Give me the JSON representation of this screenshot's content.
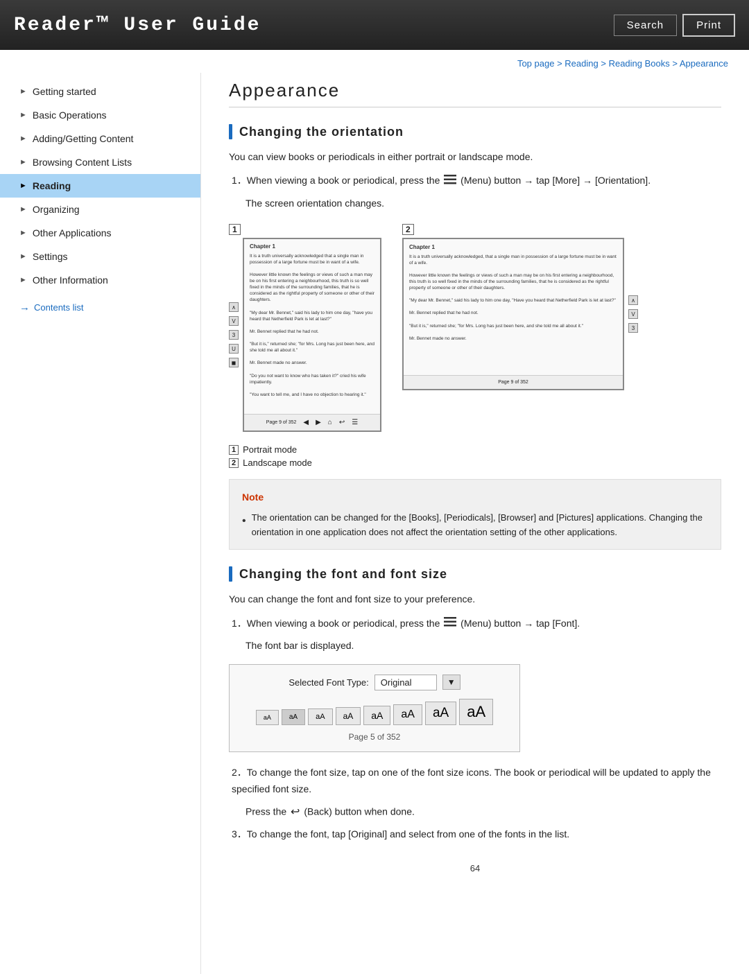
{
  "header": {
    "title": "Reader™ User Guide",
    "search_label": "Search",
    "print_label": "Print"
  },
  "breadcrumb": {
    "items": [
      "Top page",
      "Reading",
      "Reading Books",
      "Appearance"
    ],
    "separator": " > "
  },
  "sidebar": {
    "items": [
      {
        "id": "getting-started",
        "label": "Getting started",
        "active": false
      },
      {
        "id": "basic-operations",
        "label": "Basic Operations",
        "active": false
      },
      {
        "id": "adding-getting-content",
        "label": "Adding/Getting Content",
        "active": false
      },
      {
        "id": "browsing-content-lists",
        "label": "Browsing Content Lists",
        "active": false
      },
      {
        "id": "reading",
        "label": "Reading",
        "active": true
      },
      {
        "id": "organizing",
        "label": "Organizing",
        "active": false
      },
      {
        "id": "other-applications",
        "label": "Other Applications",
        "active": false
      },
      {
        "id": "settings",
        "label": "Settings",
        "active": false
      },
      {
        "id": "other-information",
        "label": "Other Information",
        "active": false
      }
    ],
    "contents_link": "Contents list"
  },
  "main": {
    "page_title": "Appearance",
    "section1": {
      "heading": "Changing the orientation",
      "intro": "You can view books or periodicals in either portrait or landscape mode.",
      "step1_prefix": "1．When viewing a book or periodical, press the",
      "step1_menu_label": "(Menu) button",
      "step1_arrow": "→",
      "step1_tap": "tap [More]",
      "step1_arrow2": "→",
      "step1_suffix": "[Orientation].",
      "step1_sub": "The screen orientation changes.",
      "mode_label1_num": "1",
      "mode_label1_text": "Portrait mode",
      "mode_label2_num": "2",
      "mode_label2_text": "Landscape mode",
      "note_title": "Note",
      "note_text": "The orientation can be changed for the [Books], [Periodicals], [Browser] and [Pictures] applications. Changing the orientation in one application does not affect the orientation setting of the other applications."
    },
    "section2": {
      "heading": "Changing the font and font size",
      "intro": "You can change the font and font size to your preference.",
      "step1_prefix": "1．When viewing a book or periodical, press the",
      "step1_menu_label": "(Menu) button",
      "step1_arrow": "→",
      "step1_tap": "tap [Font].",
      "step1_sub": "The font bar is displayed.",
      "font_bar": {
        "label": "Selected Font Type:",
        "value": "Original",
        "sizes": [
          "aA",
          "aA",
          "aA",
          "aA",
          "aA",
          "aA",
          "aA",
          "aA"
        ],
        "page": "Page 5 of 352"
      },
      "step2": "2．To change the font size, tap on one of the font size icons. The book or periodical will be updated to apply the specified font size.",
      "step2_sub_prefix": "Press the",
      "step2_sub_suffix": "(Back) button when done.",
      "step3": "3．To change the font, tap [Original] and select from one of the fonts in the list."
    },
    "page_number": "64"
  },
  "device_screen_text": {
    "portrait_lines": [
      "Chapter 1",
      "",
      "It is a truth universally acknowledged that a single man in possession of a large fortune must be in want of a wife.",
      "",
      "However little known the feelings or views of such a man may be on his first entering a neighbourhood, this truth is so well fixed in the minds of the surrounding families, that he is considered as the rightful property of someone or other of their daughters.",
      "",
      "\"My dear Mr. Bennet,\" said his lady to him one day, \"have you heard that Netherfield Park is let at last?\"",
      "",
      "Mr. Bennet replied that he had not.",
      "",
      "\"But it is,\" returned she; \"for Mrs. Long has just been here, and she told me all about it.\"",
      "",
      "Mr. Bennet made no answer.",
      "",
      "\"Do you not want to know who has taken it?\" cried his wife impatiently.",
      "",
      "\"You want to tell me, and I have no objection to hearing it.\"",
      "",
      "Page 9 of 352"
    ],
    "landscape_lines": [
      "Chapter 1",
      "",
      "It is a truth universally acknowledged, that a single man in possession of a large fortune must be in want of a wife.",
      "",
      "However little known the feelings or views of such a man may be on his first entering a neighbourhood, this truth is so well fixed in the minds of the surrounding families, that he is considered as the rightful property of someone or other of their daughters.",
      "",
      "\"My dear Mr. Bennet,\" said his lady to him one day, \"Have you heard that Netherfield Park is let at last?\"",
      "",
      "Mr. Bennet replied that he had not.",
      "",
      "\"But it is,\" returned she; \"for Mrs. Long has just been here, and she told me all about it.\"",
      "",
      "Mr. Bennet made no answer."
    ]
  }
}
